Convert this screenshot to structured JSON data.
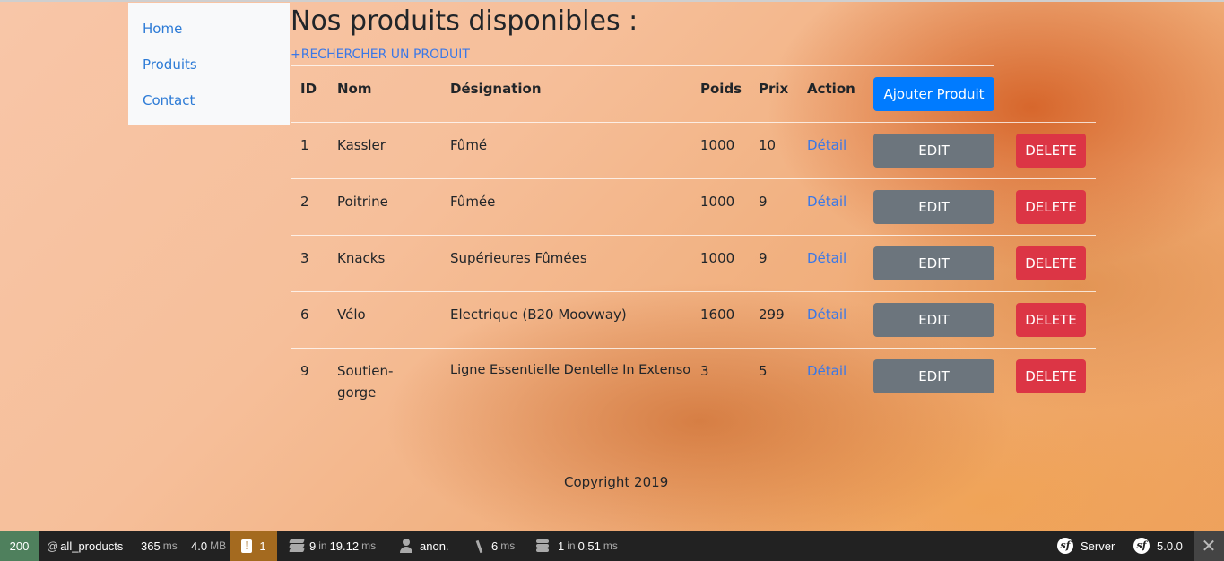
{
  "nav": {
    "items": [
      "Home",
      "Produits",
      "Contact"
    ]
  },
  "page": {
    "title": "Nos produits disponibles :",
    "search_link": "+RECHERCHER UN PRODUIT",
    "add_button": "Ajouter Produit",
    "copyright": "Copyright 2019"
  },
  "table": {
    "headers": {
      "id": "ID",
      "nom": "Nom",
      "designation": "Désignation",
      "poids": "Poids",
      "prix": "Prix",
      "action": "Action"
    },
    "detail_label": "Détail",
    "edit_label": "EDIT",
    "delete_label": "DELETE",
    "rows": [
      {
        "id": "1",
        "nom": "Kassler",
        "nom2": "",
        "designation": "Fûmé",
        "poids": "1000",
        "prix": "10"
      },
      {
        "id": "2",
        "nom": "Poitrine",
        "nom2": "",
        "designation": "Fûmée",
        "poids": "1000",
        "prix": "9"
      },
      {
        "id": "3",
        "nom": "Knacks",
        "nom2": "",
        "designation": "Supérieures Fûmées",
        "poids": "1000",
        "prix": "9"
      },
      {
        "id": "6",
        "nom": "Vélo",
        "nom2": "",
        "designation": "Electrique (B20 Moovway)",
        "poids": "1600",
        "prix": "299"
      },
      {
        "id": "9",
        "nom": "Soutien-",
        "nom2": "gorge",
        "designation": "Ligne Essentielle Dentelle In Extenso",
        "poids": "3",
        "prix": "5"
      }
    ]
  },
  "toolbar": {
    "status": "200",
    "route": "all_products",
    "time_value": "365",
    "time_unit": "ms",
    "memory_value": "4.0",
    "memory_unit": "MB",
    "warnings": "1",
    "twig_count": "9",
    "twig_in": "in",
    "twig_time": "19.12",
    "twig_unit": "ms",
    "user": "anon.",
    "events_time": "6",
    "events_unit": "ms",
    "db_count": "1",
    "db_in": "in",
    "db_time": "0.51",
    "db_unit": "ms",
    "server_label": "Server",
    "version": "5.0.0",
    "close_glyph": "✕"
  }
}
